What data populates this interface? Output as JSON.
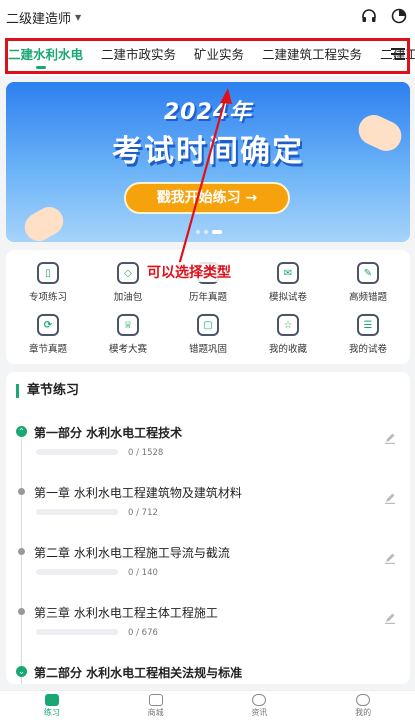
{
  "header": {
    "exam_level": "二级建造师",
    "headset_icon": "headset-icon",
    "timer_icon": "timer-icon"
  },
  "tabs": [
    {
      "label": "二建水利水电",
      "active": true
    },
    {
      "label": "二建市政实务",
      "active": false
    },
    {
      "label": "矿业实务",
      "active": false
    },
    {
      "label": "二建建筑工程实务",
      "active": false
    },
    {
      "label": "二建工程",
      "active": false
    }
  ],
  "banner": {
    "year": "2024年",
    "title": "考试时间确定",
    "button": "戳我开始练习 →"
  },
  "annotation": "可以选择类型",
  "grid": [
    {
      "label": "专项练习",
      "icon": "special-practice-icon"
    },
    {
      "label": "加油包",
      "icon": "diamond-icon"
    },
    {
      "label": "历年真题",
      "icon": "past-papers-icon"
    },
    {
      "label": "模拟试卷",
      "icon": "mock-paper-icon"
    },
    {
      "label": "高频错题",
      "icon": "frequent-errors-icon"
    },
    {
      "label": "章节真题",
      "icon": "chapter-questions-icon"
    },
    {
      "label": "模考大赛",
      "icon": "trophy-icon"
    },
    {
      "label": "错题巩固",
      "icon": "error-review-icon"
    },
    {
      "label": "我的收藏",
      "icon": "favorites-icon"
    },
    {
      "label": "我的试卷",
      "icon": "my-papers-icon"
    }
  ],
  "section": {
    "title": "章节练习",
    "nodes": [
      {
        "title": "第一部分 水利水电工程技术",
        "count": "0 / 1528",
        "type": "part"
      },
      {
        "title": "第一章 水利水电工程建筑物及建筑材料",
        "count": "0 / 712",
        "type": "chapter"
      },
      {
        "title": "第二章 水利水电工程施工导流与截流",
        "count": "0 / 140",
        "type": "chapter"
      },
      {
        "title": "第三章 水利水电工程主体工程施工",
        "count": "0 / 676",
        "type": "chapter"
      },
      {
        "title": "第二部分 水利水电工程相关法规与标准",
        "count": "",
        "type": "part"
      }
    ]
  },
  "bottom_nav": [
    {
      "label": "练习",
      "active": true
    },
    {
      "label": "商城",
      "active": false
    },
    {
      "label": "资讯",
      "active": false
    },
    {
      "label": "我的",
      "active": false
    }
  ],
  "colors": {
    "accent": "#1aa872",
    "annotation_red": "#e0101b",
    "banner_button": "#f5a20d"
  }
}
